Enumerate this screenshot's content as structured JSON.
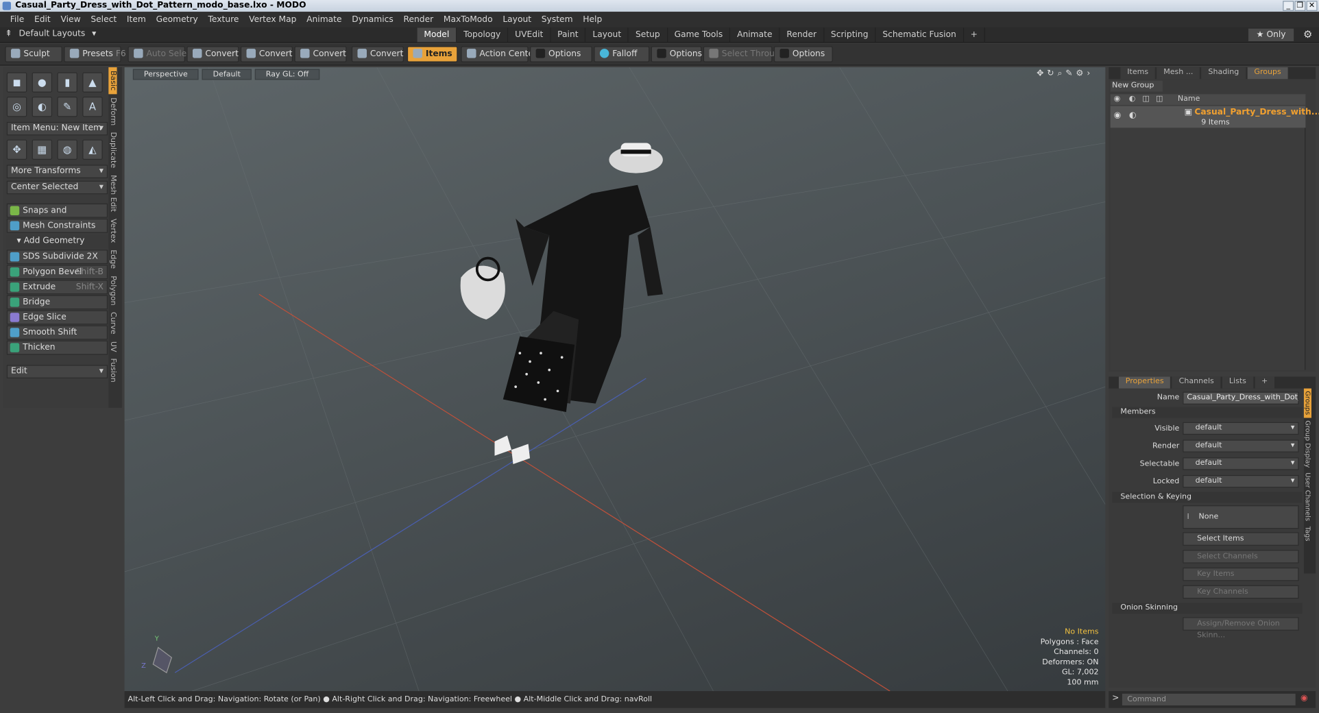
{
  "window": {
    "title": "Casual_Party_Dress_with_Dot_Pattern_modo_base.lxo - MODO",
    "controls": [
      "_",
      "❐",
      "✕"
    ]
  },
  "menu": [
    "File",
    "Edit",
    "View",
    "Select",
    "Item",
    "Geometry",
    "Texture",
    "Vertex Map",
    "Animate",
    "Dynamics",
    "Render",
    "MaxToModo",
    "Layout",
    "System",
    "Help"
  ],
  "modebar": {
    "layouts_label": "Default Layouts",
    "tabs": [
      "Model",
      "Topology",
      "UVEdit",
      "Paint",
      "Layout",
      "Setup",
      "Game Tools",
      "Animate",
      "Render",
      "Scripting",
      "Schematic Fusion"
    ],
    "active_tab": "Model",
    "add": "+",
    "only": "★  Only"
  },
  "toolbar": {
    "sculpt": "Sculpt",
    "presets": "Presets",
    "presets_key": "F6",
    "auto_select": "Auto Select",
    "convert": "Convert",
    "items": "Items",
    "action_center": "Action Center",
    "options": "Options",
    "falloff": "Falloff",
    "select_through": "Select Through"
  },
  "left": {
    "item_menu": "Item Menu: New Item",
    "more_transforms": "More Transforms",
    "center_selected": "Center Selected",
    "snaps": "Snaps and Precision",
    "mesh_constraints": "Mesh Constraints",
    "add_geometry": "Add Geometry",
    "tools": [
      {
        "label": "SDS Subdivide 2X",
        "shortcut": ""
      },
      {
        "label": "Polygon Bevel",
        "shortcut": "Shift-B"
      },
      {
        "label": "Extrude",
        "shortcut": "Shift-X"
      },
      {
        "label": "Bridge",
        "shortcut": ""
      },
      {
        "label": "Edge Slice",
        "shortcut": ""
      },
      {
        "label": "Smooth Shift",
        "shortcut": ""
      },
      {
        "label": "Thicken",
        "shortcut": ""
      }
    ],
    "edit": "Edit",
    "side_tabs": [
      "Basic",
      "Deform",
      "Duplicate",
      "Mesh Edit",
      "Vertex",
      "Edge",
      "Polygon",
      "Curve",
      "UV",
      "Fusion"
    ]
  },
  "viewport": {
    "perspective": "Perspective",
    "shading": "Default",
    "raygl": "Ray GL: Off",
    "info": {
      "items": "No Items",
      "polygons": "Polygons : Face",
      "channels": "Channels: 0",
      "deformers": "Deformers: ON",
      "gl": "GL: 7,002",
      "unit": "100 mm"
    },
    "status": "Alt-Left Click and Drag: Navigation: Rotate (or Pan) ● Alt-Right Click and Drag: Navigation: Freewheel ● Alt-Middle Click and Drag: navRoll"
  },
  "groups_panel": {
    "tabs": [
      "Items",
      "Mesh ...",
      "Shading",
      "Groups"
    ],
    "active": "Groups",
    "new_group": "New Group",
    "col_name": "Name",
    "group_name": "Casual_Party_Dress_with...",
    "group_count": "9 Items"
  },
  "properties": {
    "tabs": [
      "Properties",
      "Channels",
      "Lists"
    ],
    "add": "+",
    "name_label": "Name",
    "name_value": "Casual_Party_Dress_with_Dot_P",
    "members": "Members",
    "fields": [
      {
        "label": "Visible",
        "value": "default"
      },
      {
        "label": "Render",
        "value": "default"
      },
      {
        "label": "Selectable",
        "value": "default"
      },
      {
        "label": "Locked",
        "value": "default"
      }
    ],
    "selection_keying": "Selection & Keying",
    "none": "None",
    "select_items": "Select Items",
    "select_channels": "Select Channels",
    "key_items": "Key Items",
    "key_channels": "Key Channels",
    "onion": "Onion Skinning",
    "assign_onion": "Assign/Remove Onion Skinn...",
    "side_tabs": [
      "Groups",
      "Group Display",
      "User Channels",
      "Tags"
    ]
  },
  "command": {
    "prompt": ">",
    "placeholder": "Command"
  }
}
